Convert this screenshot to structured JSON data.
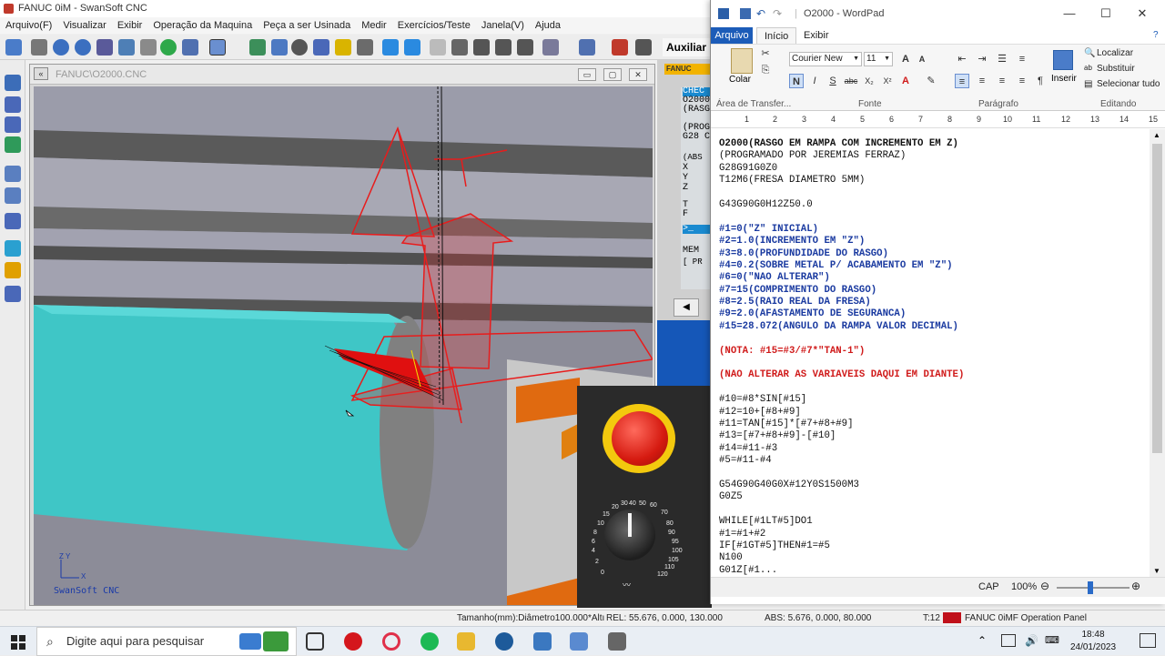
{
  "swansoft": {
    "title": "FANUC 0iM - SwanSoft CNC",
    "menu": [
      "Arquivo(F)",
      "Visualizar",
      "Exibir",
      "Operação da Maquina",
      "Peça a ser Usinada",
      "Medir",
      "Exercícios/Teste",
      "Janela(V)",
      "Ajuda"
    ],
    "auxiliar_label": "Auxiliar",
    "viewport_title": "FANUC\\O2000.CNC",
    "viewport_logo": "SwanSoft CNC",
    "axes_label_zy": "Z Y",
    "axes_label_x": "X",
    "fanuc_tag": "FANUC",
    "fanuc_screen_lines": [
      "CHEC",
      "O2000",
      "(RASG",
      "",
      "(PROG",
      "G28 C",
      "",
      "(ABS",
      "X",
      "Y",
      "Z",
      "",
      "T",
      "F",
      "",
      ">_",
      "",
      "MEM",
      "[ PR"
    ],
    "dial_numbers": [
      "20",
      "30",
      "40",
      "50",
      "60",
      "70",
      "80",
      "90",
      "95",
      "100",
      "105",
      "110",
      "120",
      "15",
      "10",
      "8",
      "6",
      "4",
      "2",
      "0"
    ],
    "status": {
      "tamanho": "Tamanho(mm):Diâmetro100.000*Altı",
      "rel": "REL:  55.676,   0.000,  130.000",
      "abs": "ABS:  5.676,   0.000,   80.000",
      "tool": "T:12",
      "panel": "FANUC 0iMF Operation Panel"
    }
  },
  "wordpad": {
    "title": "O2000 - WordPad",
    "tabs": [
      "Arquivo",
      "Início",
      "Exibir"
    ],
    "clipboard": {
      "paste_label": "Colar",
      "group": "Área de Transfer..."
    },
    "font": {
      "name": "Courier New",
      "size": "11",
      "group": "Fonte"
    },
    "paragraph_group": "Parágrafo",
    "insert_label": "Inserir",
    "editing": {
      "find": "Localizar",
      "replace": "Substituir",
      "select_all": "Selecionar tudo",
      "group": "Editando"
    },
    "ruler_ticks": [
      "1",
      "2",
      "3",
      "4",
      "5",
      "6",
      "7",
      "8",
      "9",
      "10",
      "11",
      "12",
      "13",
      "14",
      "15"
    ],
    "document_lines": [
      {
        "text": "O2000(RASGO EM RAMPA COM INCREMENTO EM Z)",
        "style": "black bold"
      },
      {
        "text": "(PROGRAMADO POR JEREMIAS FERRAZ)",
        "style": "black"
      },
      {
        "text": "G28G91G0Z0",
        "style": "black"
      },
      {
        "text": "T12M6(FRESA DIAMETRO 5MM)",
        "style": "black"
      },
      {
        "text": "",
        "style": "black"
      },
      {
        "text": "G43G90G0H12Z50.0",
        "style": "black"
      },
      {
        "text": "",
        "style": "black"
      },
      {
        "text": "#1=0(\"Z\" INICIAL)",
        "style": "blue"
      },
      {
        "text": "#2=1.0(INCREMENTO EM \"Z\")",
        "style": "blue"
      },
      {
        "text": "#3=8.0(PROFUNDIDADE DO RASGO)",
        "style": "blue"
      },
      {
        "text": "#4=0.2(SOBRE METAL P/ ACABAMENTO EM \"Z\")",
        "style": "blue"
      },
      {
        "text": "#6=0(\"NAO ALTERAR\")",
        "style": "blue"
      },
      {
        "text": "#7=15(COMPRIMENTO DO RASGO)",
        "style": "blue"
      },
      {
        "text": "#8=2.5(RAIO REAL DA FRESA)",
        "style": "blue"
      },
      {
        "text": "#9=2.0(AFASTAMENTO DE SEGURANCA)",
        "style": "blue"
      },
      {
        "text": "#15=28.072(ANGULO DA RAMPA VALOR DECIMAL)",
        "style": "blue"
      },
      {
        "text": "",
        "style": "black"
      },
      {
        "text": "(NOTA: #15=#3/#7*\"TAN-1\")",
        "style": "red"
      },
      {
        "text": "",
        "style": "black"
      },
      {
        "text": "(NAO ALTERAR AS VARIAVEIS DAQUI EM DIANTE)",
        "style": "red"
      },
      {
        "text": "",
        "style": "black"
      },
      {
        "text": "#10=#8*SIN[#15]",
        "style": "black"
      },
      {
        "text": "#12=10+[#8+#9]",
        "style": "black"
      },
      {
        "text": "#11=TAN[#15]*[#7+#8+#9]",
        "style": "black"
      },
      {
        "text": "#13=[#7+#8+#9]-[#10]",
        "style": "black"
      },
      {
        "text": "#14=#11-#3",
        "style": "black"
      },
      {
        "text": "#5=#11-#4",
        "style": "black"
      },
      {
        "text": "",
        "style": "black"
      },
      {
        "text": "G54G90G40G0X#12Y0S1500M3",
        "style": "black"
      },
      {
        "text": "G0Z5",
        "style": "black"
      },
      {
        "text": "",
        "style": "black"
      },
      {
        "text": "WHILE[#1LT#5]DO1",
        "style": "black"
      },
      {
        "text": "#1=#1+#2",
        "style": "black"
      },
      {
        "text": "IF[#1GT#5]THEN#1=#5",
        "style": "black"
      },
      {
        "text": "N100",
        "style": "black"
      },
      {
        "text": "G01Z[#1...",
        "style": "black"
      }
    ],
    "status": {
      "caps": "CAP",
      "zoom": "100%"
    }
  },
  "taskbar": {
    "search_placeholder": "Digite aqui para pesquisar",
    "time": "18:48",
    "date": "24/01/2023"
  },
  "colors": {
    "wordpad_accent": "#1c5cb8",
    "code_blue": "#1a3aa0",
    "code_red": "#d01b1b",
    "workpiece": "#3fc6c6",
    "toolpath": "#e81c1c"
  }
}
